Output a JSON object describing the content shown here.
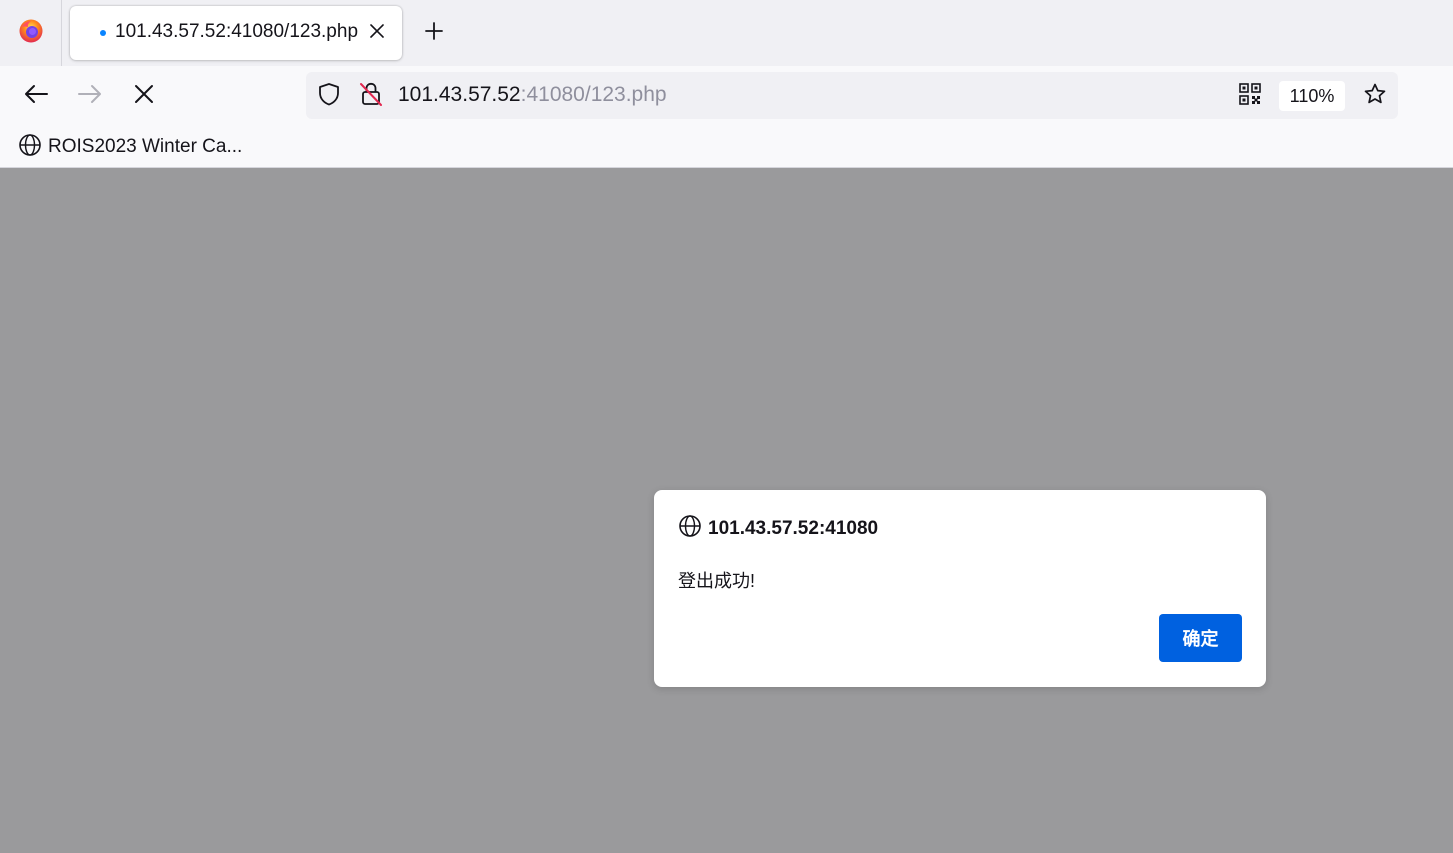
{
  "browser": {
    "tab": {
      "title": "101.43.57.52:41080/123.php",
      "loading_dot_color": "#0a84ff"
    },
    "icons": {
      "app": "firefox-icon",
      "tab_close": "close-icon",
      "new_tab": "plus-icon",
      "back": "back-arrow-icon",
      "forward": "forward-arrow-icon",
      "stop": "stop-icon",
      "tracking": "shield-icon",
      "insecure": "insecure-lock-icon",
      "qr": "qr-code-icon",
      "bookmark": "star-icon",
      "bookmark_item": "globe-icon"
    },
    "urlbar": {
      "host": "101.43.57.52",
      "rest": ":41080/123.php",
      "zoom": "110%"
    },
    "bookmarks_bar": {
      "items": [
        {
          "label": "ROIS2023 Winter Ca..."
        }
      ]
    }
  },
  "page": {
    "overlay_color": "#9a9a9c"
  },
  "dialog": {
    "origin": "101.43.57.52:41080",
    "message": "登出成功!",
    "ok_label": "确定",
    "ok_color": "#0061e0"
  }
}
